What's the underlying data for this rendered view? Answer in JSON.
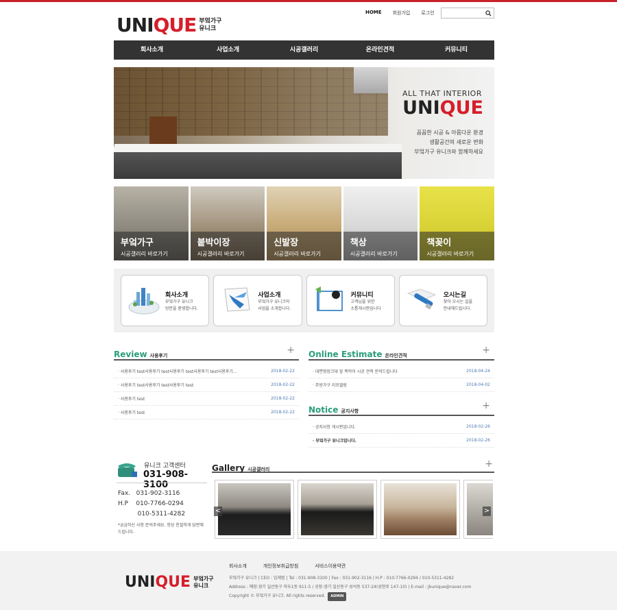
{
  "header": {
    "logo_main": "UNI",
    "logo_accent": "QUE",
    "logo_sub1": "부엌가구",
    "logo_sub2": "유니크",
    "top_links": [
      "HOME",
      "회원가입",
      "로그인"
    ],
    "search_icon": "search-icon"
  },
  "gnb": [
    "회사소개",
    "사업소개",
    "시공갤러리",
    "온라인견적",
    "커뮤니티"
  ],
  "hero": {
    "tagline": "ALL THAT INTERIOR",
    "brand_main": "UNI",
    "brand_accent": "QUE",
    "copy1": "꼼꼼한 시공 & 아름다운 환경",
    "copy2": "생활공간의 새로운 변화",
    "copy3": "부엌가구 유니크와 함께하세요"
  },
  "categories": [
    {
      "title": "부엌가구",
      "sub": "시공갤러리 바로가기"
    },
    {
      "title": "붙박이장",
      "sub": "시공갤러리 바로가기"
    },
    {
      "title": "신발장",
      "sub": "시공갤러리 바로가기"
    },
    {
      "title": "책상",
      "sub": "시공갤러리 바로가기"
    },
    {
      "title": "책꽂이",
      "sub": "시공갤러리 바로가기"
    }
  ],
  "quick": [
    {
      "title": "회사소개",
      "d1": "부엌가구 유니크",
      "d2": "방문을 환영합니다."
    },
    {
      "title": "사업소개",
      "d1": "부엌가구 유니크의",
      "d2": "사업을 소개합니다."
    },
    {
      "title": "커뮤니티",
      "d1": "고객님을 위한",
      "d2": "소통게시판입니다"
    },
    {
      "title": "오시는길",
      "d1": "찾아 오시는 길을",
      "d2": "안내해드립니다."
    }
  ],
  "review": {
    "en": "Review",
    "ko": "사용후기",
    "plus": "+",
    "rows": [
      {
        "title": "· 사용후기 test사용후기 test사용후기 test사용후기 test사용후기…",
        "date": "2018-02-22"
      },
      {
        "title": "· 사용후기 test사용후기 test사용후기 test",
        "date": "2018-02-22"
      },
      {
        "title": "· 사용후기 test",
        "date": "2018-02-22"
      },
      {
        "title": "· 사용후기 test",
        "date": "2018-02-22"
      }
    ]
  },
  "estimate": {
    "en": "Online Estimate",
    "ko": "온라인견적",
    "plus": "+",
    "rows": [
      {
        "title": "· 대면형씽크대 앞 쪽막이 시공 견적 문의드립니다",
        "date": "2018-04-24"
      },
      {
        "title": "· 주방가구 리모델링",
        "date": "2018-04-02"
      }
    ]
  },
  "notice": {
    "en": "Notice",
    "ko": "공지사항",
    "plus": "+",
    "rows": [
      {
        "title": "· 공지사항 게시판입니다.",
        "date": "2018-02-26"
      },
      {
        "title": "· 부엌가구 유니크입니다.",
        "date": "2018-02-26"
      }
    ]
  },
  "customer_center": {
    "title": "유니크 고객센터",
    "phone": "031-908-3100",
    "fax_line": "Fax.   031-902-3116",
    "hp_line": "H.P    010-7766-0294",
    "hp2_line": "          010-5311-4282",
    "note": "*궁금하신 사항 문의주세요. 항상 친절하게 답변해드립니다."
  },
  "gallery": {
    "en": "Gallery",
    "ko": "시공갤러리",
    "plus": "+",
    "prev": "<",
    "next": ">"
  },
  "footer": {
    "links": [
      "회사소개",
      "개인정보취급방침",
      "서비스이용약관"
    ],
    "line1": "부엌가구 유니크  |  CEO : 임재범  |  Tel : 031-908-3100  |  Fax : 031-902-3116  |  H.P : 010-7766-0294 / 010-5311-4282",
    "line2": "Address : 매장:경기 일산동구 마두1동 911-5 / 공장:경기 일산동구 성석동 537-24(성현로 147-10)  |  E-mail : jbunique@naver.com",
    "copyright": "Copyright © 부엌가구 유니크. All rights reserved.",
    "admin": "ADMIN",
    "logo_main": "UNI",
    "logo_accent": "QUE",
    "logo_sub1": "부엌가구",
    "logo_sub2": "유니크"
  },
  "colors": {
    "accent": "#d51f2b",
    "nav": "#333333",
    "board_title": "#2a9d7a",
    "date": "#4a78b3"
  }
}
